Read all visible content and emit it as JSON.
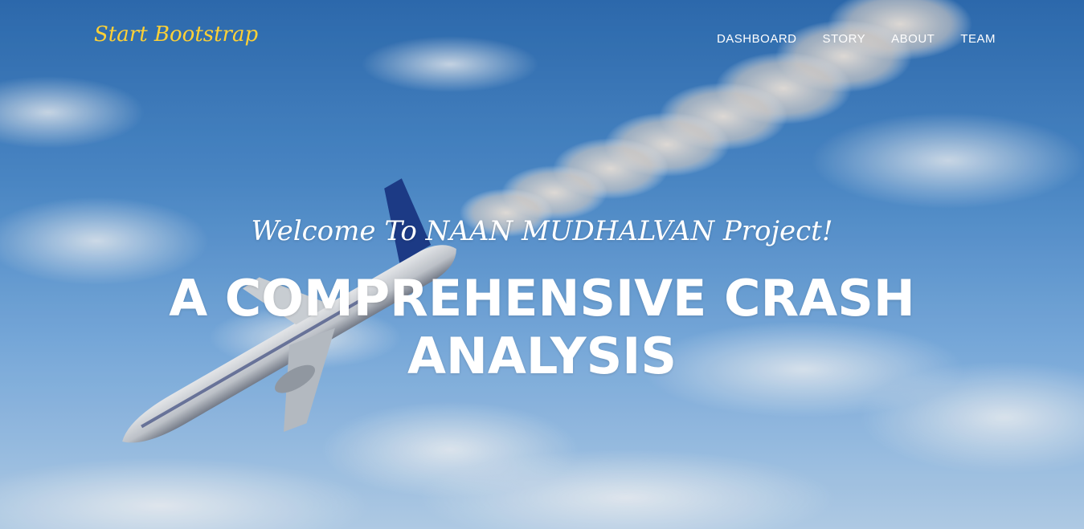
{
  "navbar": {
    "brand": "Start Bootstrap",
    "links": [
      "DASHBOARD",
      "STORY",
      "ABOUT",
      "TEAM"
    ]
  },
  "intro": {
    "lead_in": "Welcome To NAAN MUDHALVAN Project!",
    "heading": "A COMPREHENSIVE CRASH ANALYSIS"
  },
  "colors": {
    "brand": "#fed136",
    "nav_text": "#ffffff",
    "sky_top": "#2f6fb6",
    "sky_bottom": "#b9d6f2"
  }
}
